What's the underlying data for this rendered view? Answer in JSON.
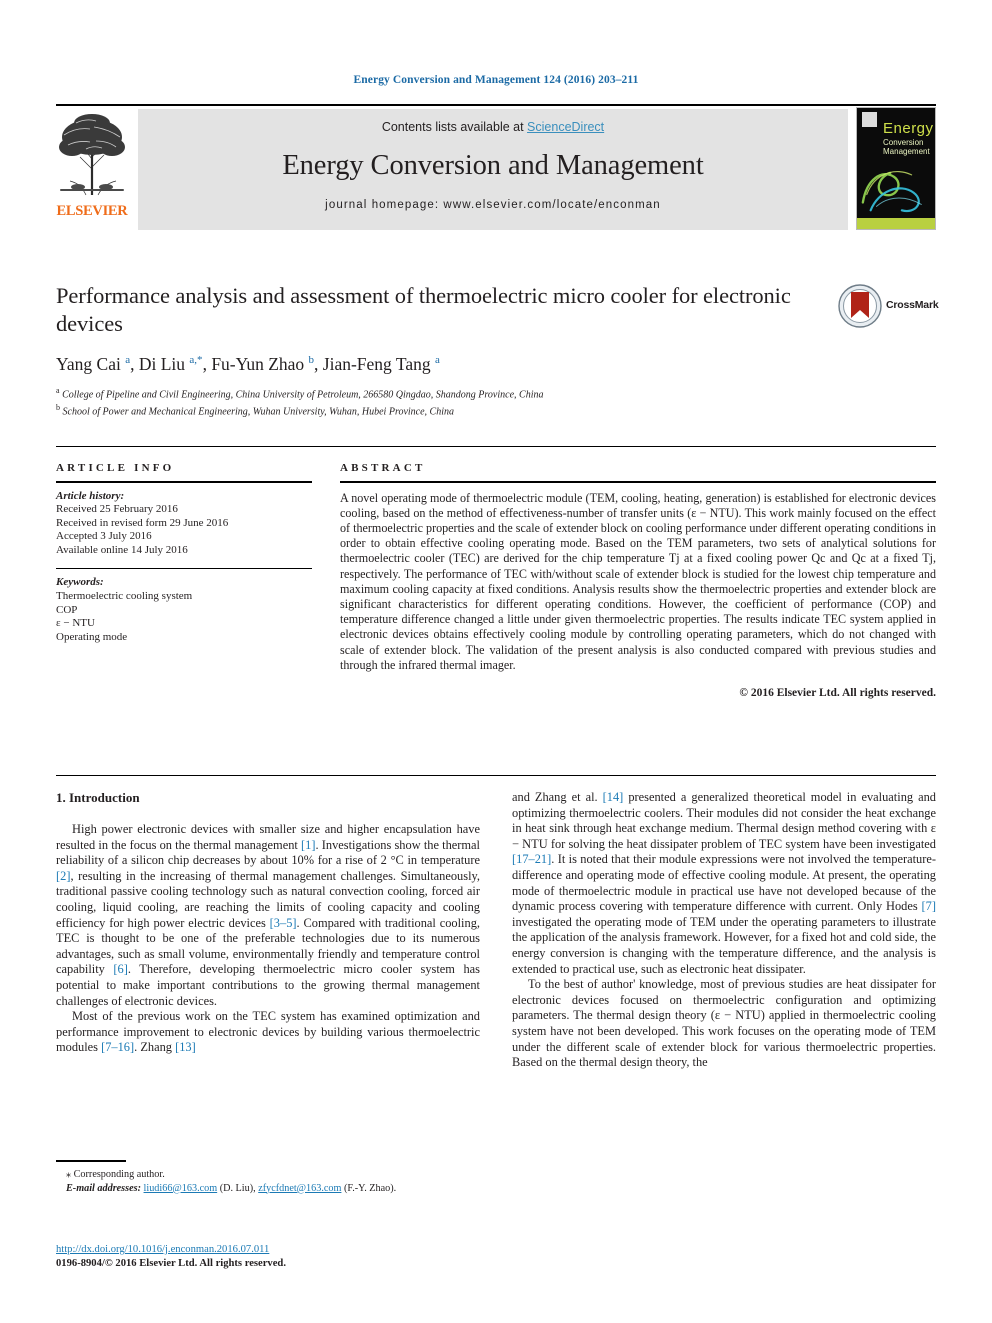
{
  "running_head": "Energy Conversion and Management 124 (2016) 203–211",
  "masthead": {
    "contents_prefix": "Contents lists available at ",
    "sciencedirect": "ScienceDirect",
    "journal_title": "Energy Conversion and Management",
    "homepage": "journal homepage: www.elsevier.com/locate/enconman",
    "publisher": "ELSEVIER",
    "cover": {
      "title": "Energy",
      "subtitle_line1": "Conversion",
      "subtitle_line2": "Management",
      "amp": "&"
    }
  },
  "article": {
    "title": "Performance analysis and assessment of thermoelectric micro cooler for electronic devices",
    "crossmark_label": "CrossMark",
    "authors_html": "Yang Cai <sup class=\"aff-mark\">a</sup>, Di Liu <sup class=\"aff-mark\">a,*</sup>, Fu-Yun Zhao <sup class=\"aff-mark\">b</sup>, Jian-Feng Tang <sup class=\"aff-mark\">a</sup>",
    "affiliation_a": "College of Pipeline and Civil Engineering, China University of Petroleum, 266580 Qingdao, Shandong Province, China",
    "affiliation_b": "School of Power and Mechanical Engineering, Wuhan University, Wuhan, Hubei Province, China"
  },
  "article_info": {
    "label": "ARTICLE INFO",
    "history_head": "Article history:",
    "history": [
      "Received 25 February 2016",
      "Received in revised form 29 June 2016",
      "Accepted 3 July 2016",
      "Available online 14 July 2016"
    ],
    "keywords_head": "Keywords:",
    "keywords": [
      "Thermoelectric cooling system",
      "COP",
      "ε − NTU",
      "Operating mode"
    ]
  },
  "abstract": {
    "label": "ABSTRACT",
    "text": "A novel operating mode of thermoelectric module (TEM, cooling, heating, generation) is established for electronic devices cooling, based on the method of effectiveness-number of transfer units (ε − NTU). This work mainly focused on the effect of thermoelectric properties and the scale of extender block on cooling performance under different operating conditions in order to obtain effective cooling operating mode. Based on the TEM parameters, two sets of analytical solutions for thermoelectric cooler (TEC) are derived for the chip temperature Tj at a fixed cooling power Qc and Qc at a fixed Tj, respectively. The performance of TEC with/without scale of extender block is studied for the lowest chip temperature and maximum cooling capacity at fixed conditions. Analysis results show the thermoelectric properties and extender block are significant characteristics for different operating conditions. However, the coefficient of performance (COP) and temperature difference changed a little under given thermoelectric properties. The results indicate TEC system applied in electronic devices obtains effectively cooling module by controlling operating parameters, which do not changed with scale of extender block. The validation of the present analysis is also conducted compared with previous studies and through the infrared thermal imager.",
    "copyright": "© 2016 Elsevier Ltd. All rights reserved."
  },
  "body": {
    "section1_heading": "1. Introduction",
    "left_par1": "High power electronic devices with smaller size and higher encapsulation have resulted in the focus on the thermal management [1]. Investigations show the thermal reliability of a silicon chip decreases by about 10% for a rise of 2 °C in temperature [2], resulting in the increasing of thermal management challenges. Simultaneously, traditional passive cooling technology such as natural convection cooling, forced air cooling, liquid cooling, are reaching the limits of cooling capacity and cooling efficiency for high power electric devices [3–5]. Compared with traditional cooling, TEC is thought to be one of the preferable technologies due to its numerous advantages, such as small volume, environmentally friendly and temperature control capability [6]. Therefore, developing thermoelectric micro cooler system has potential to make important contributions to the growing thermal management challenges of electronic devices.",
    "left_par2": "Most of the previous work on the TEC system has examined optimization and performance improvement to electronic devices by building various thermoelectric modules [7–16]. Zhang [13]",
    "right_par1": "and Zhang et al. [14] presented a generalized theoretical model in evaluating and optimizing thermoelectric coolers. Their modules did not consider the heat exchange in heat sink through heat exchange medium. Thermal design method covering with ε − NTU for solving the heat dissipater problem of TEC system have been investigated [17–21]. It is noted that their module expressions were not involved the temperature-difference and operating mode of effective cooling module. At present, the operating mode of thermoelectric module in practical use have not developed because of the dynamic process covering with temperature difference with current. Only Hodes [7] investigated the operating mode of TEM under the operating parameters to illustrate the application of the analysis framework. However, for a fixed hot and cold side, the energy conversion is changing with the temperature difference, and the analysis is extended to practical use, such as electronic heat dissipater.",
    "right_par2": "To the best of author' knowledge, most of previous studies are heat dissipater for electronic devices focused on thermoelectric configuration and optimizing parameters. The thermal design theory (ε − NTU) applied in thermoelectric cooling system have not been developed. This work focuses on the operating mode of TEM under the different scale of extender block for various thermoelectric properties. Based on the thermal design theory, the"
  },
  "footnotes": {
    "corresponding": "Corresponding author.",
    "email_label": "E-mail addresses:",
    "email1": "liudi66@163.com",
    "email1_owner": "(D. Liu),",
    "email2": "zfycfdnet@163.com",
    "email2_owner": "(F.-Y. Zhao).",
    "doi": "http://dx.doi.org/10.1016/j.enconman.2016.07.011",
    "issn_line": "0196-8904/© 2016 Elsevier Ltd. All rights reserved."
  },
  "colors": {
    "link": "#1b7ab5",
    "running_head": "#1b6aa5",
    "elsevier_orange": "#ef6c1a",
    "masthead_bg": "#e3e3e3",
    "crossmark_red": "#b02318"
  }
}
